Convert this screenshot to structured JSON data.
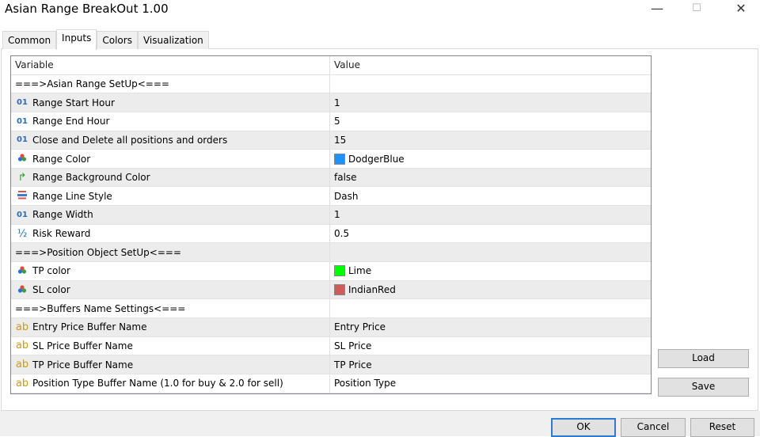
{
  "window": {
    "title": "Asian Range BreakOut 1.00",
    "minimize": "—",
    "maximize": "☐",
    "close": "✕"
  },
  "tabs": [
    {
      "label": "Common"
    },
    {
      "label": "Inputs",
      "active": true
    },
    {
      "label": "Colors"
    },
    {
      "label": "Visualization"
    }
  ],
  "grid": {
    "headers": {
      "variable": "Variable",
      "value": "Value"
    },
    "rows": [
      {
        "type": "group",
        "variable": "===>Asian Range SetUp<===",
        "value": ""
      },
      {
        "icon": "int",
        "variable": "Range Start Hour",
        "value": "1"
      },
      {
        "icon": "int",
        "variable": "Range End Hour",
        "value": "5"
      },
      {
        "icon": "int",
        "variable": "Close and Delete all positions and orders",
        "value": "15"
      },
      {
        "icon": "color",
        "variable": "Range Color",
        "value": "DodgerBlue",
        "swatch": "#1e90ff"
      },
      {
        "icon": "bool",
        "variable": "Range Background Color",
        "value": "false"
      },
      {
        "icon": "linestyle",
        "variable": "Range Line Style",
        "value": "Dash"
      },
      {
        "icon": "int",
        "variable": "Range Width",
        "value": "1"
      },
      {
        "icon": "double",
        "variable": "Risk Reward",
        "value": "0.5"
      },
      {
        "type": "group",
        "variable": "===>Position Object SetUp<===",
        "value": ""
      },
      {
        "icon": "color",
        "variable": "TP color",
        "value": "Lime",
        "swatch": "#00ff00"
      },
      {
        "icon": "color",
        "variable": "SL color",
        "value": "IndianRed",
        "swatch": "#cd5c5c"
      },
      {
        "type": "group",
        "variable": "===>Buffers Name Settings<===",
        "value": ""
      },
      {
        "icon": "string",
        "variable": "Entry Price Buffer Name",
        "value": "Entry Price"
      },
      {
        "icon": "string",
        "variable": "SL Price Buffer Name",
        "value": "SL Price"
      },
      {
        "icon": "string",
        "variable": "TP Price Buffer Name",
        "value": "TP Price"
      },
      {
        "icon": "string",
        "variable": "Position Type Buffer Name (1.0 for buy & 2.0 for sell)",
        "value": "Position Type"
      }
    ]
  },
  "buttons": {
    "load": "Load",
    "save": "Save",
    "ok": "OK",
    "cancel": "Cancel",
    "reset": "Reset"
  },
  "icons": {
    "int": "01",
    "string": "ab",
    "double": "½",
    "bool": "↱",
    "color": "♣",
    "linestyle": "☰"
  }
}
